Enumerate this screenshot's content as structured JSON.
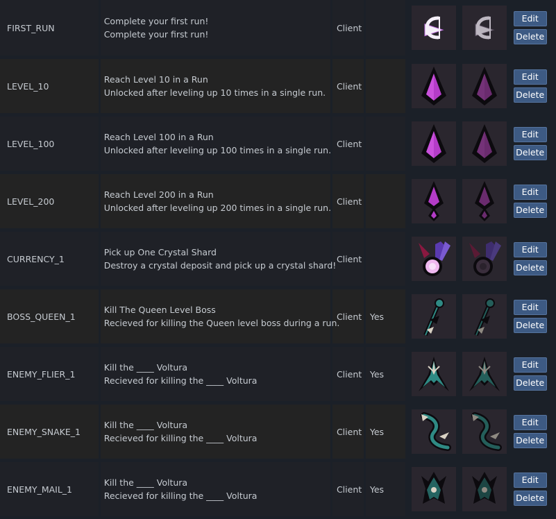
{
  "achievements": [
    {
      "api": "FIRST_RUN",
      "name": "Complete your first run!",
      "desc": "Complete your first run!",
      "side": "Client",
      "hidden": "",
      "icon": "c-mark-icon"
    },
    {
      "api": "LEVEL_10",
      "name": "Reach Level 10 in a Run",
      "desc": "Unlocked after leveling up 10 times in a single run.",
      "side": "Client",
      "hidden": "",
      "icon": "diamond-icon"
    },
    {
      "api": "LEVEL_100",
      "name": "Reach Level 100 in a Run",
      "desc": "Unlocked after leveling up 100 times in a single run.",
      "side": "Client",
      "hidden": "",
      "icon": "diamond-icon"
    },
    {
      "api": "LEVEL_200",
      "name": "Reach Level 200 in a Run",
      "desc": "Unlocked after leveling up 200 times in a single run.",
      "side": "Client",
      "hidden": "",
      "icon": "arrow-diamond-icon"
    },
    {
      "api": "CURRENCY_1",
      "name": "Pick up One Crystal Shard",
      "desc": "Destroy a crystal deposit and pick up a crystal shard!",
      "side": "Client",
      "hidden": "",
      "icon": "crystal-key-icon"
    },
    {
      "api": "BOSS_QUEEN_1",
      "name": "Kill The Queen Level Boss",
      "desc": "Recieved for killing the Queen level boss during a run.",
      "side": "Client",
      "hidden": "Yes",
      "icon": "queen-staff-icon"
    },
    {
      "api": "ENEMY_FLIER_1",
      "name": "Kill the ____ Voltura",
      "desc": "Recieved for killing the ____ Voltura",
      "side": "Client",
      "hidden": "Yes",
      "icon": "flier-icon"
    },
    {
      "api": "ENEMY_SNAKE_1",
      "name": "Kill the ____ Voltura",
      "desc": "Recieved for killing the ____ Voltura",
      "side": "Client",
      "hidden": "Yes",
      "icon": "snake-icon"
    },
    {
      "api": "ENEMY_MAIL_1",
      "name": "Kill the ____ Voltura",
      "desc": "Recieved for killing the ____ Voltura",
      "side": "Client",
      "hidden": "Yes",
      "icon": "mail-icon"
    }
  ],
  "buttons": {
    "edit": "Edit",
    "delete": "Delete"
  },
  "colors": {
    "accent_button": "#3d5a83",
    "icon_purple": "#a434b8",
    "icon_teal": "#2f7b76"
  }
}
